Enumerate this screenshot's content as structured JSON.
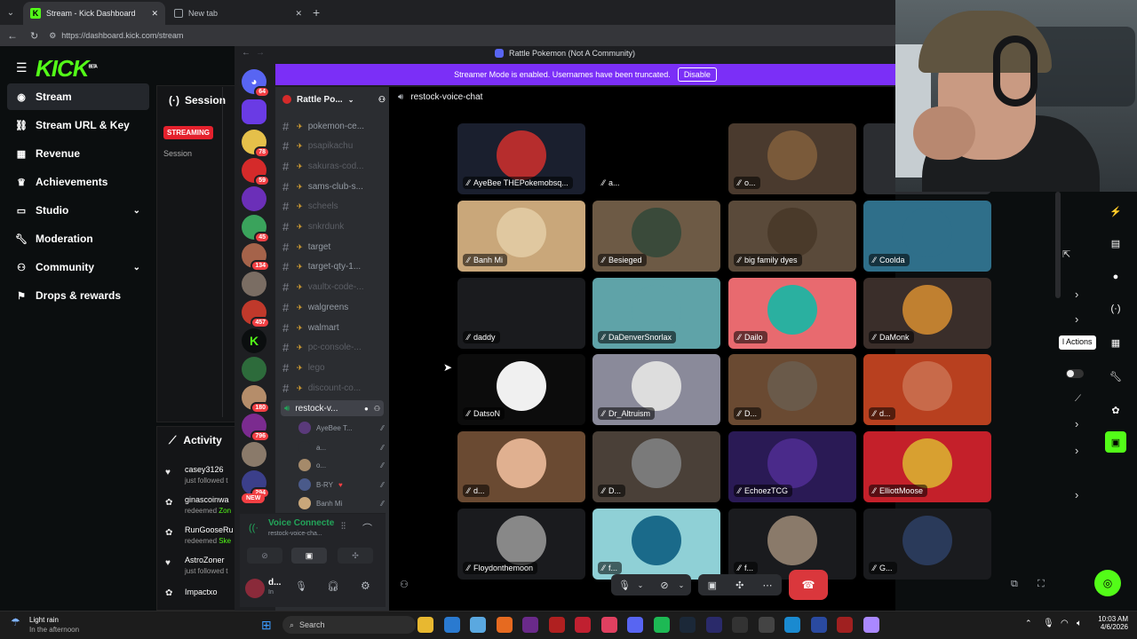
{
  "browser": {
    "tabs": [
      {
        "title": "Stream - Kick Dashboard"
      },
      {
        "title": "New tab"
      }
    ],
    "url": "https://dashboard.kick.com/stream"
  },
  "kick": {
    "logo": "KICK",
    "logo_sup": "BETA",
    "nav": [
      {
        "label": "Stream",
        "icon": "broadcast-icon"
      },
      {
        "label": "Stream URL & Key",
        "icon": "link-icon"
      },
      {
        "label": "Revenue",
        "icon": "revenue-icon"
      },
      {
        "label": "Achievements",
        "icon": "trophy-icon"
      },
      {
        "label": "Studio",
        "icon": "studio-icon"
      },
      {
        "label": "Moderation",
        "icon": "wrench-icon"
      },
      {
        "label": "Community",
        "icon": "community-icon"
      },
      {
        "label": "Drops & rewards",
        "icon": "gift-icon"
      }
    ],
    "session_title": "Session",
    "streaming_badge": "STREAMING",
    "session_label": "Session",
    "activity_title": "Activity",
    "activity": [
      {
        "name": "casey3126",
        "action": "just followed t",
        "icon": "heart-icon"
      },
      {
        "name": "ginascoinwa",
        "action": "redeemed",
        "extra": "Zon",
        "icon": "rewards-icon"
      },
      {
        "name": "RunGooseRu",
        "action": "redeemed",
        "extra": "Ske",
        "icon": "rewards-icon"
      },
      {
        "name": "AstroZoner",
        "action": "just followed t",
        "icon": "heart-icon"
      },
      {
        "name": "Impactxo",
        "action": "",
        "icon": "rewards-icon"
      }
    ],
    "quick_actions_tooltip": "l Actions"
  },
  "discord": {
    "window_title": "Rattle Pokemon (Not A Community)",
    "streamer_banner": "Streamer Mode is enabled. Usernames have been truncated.",
    "disable_label": "Disable",
    "server_name": "Rattle Po...",
    "guild_badges": [
      "64",
      "78",
      "59",
      "45",
      "134",
      "457",
      "180",
      "796",
      "294"
    ],
    "new_label": "NEW",
    "channels": [
      {
        "name": "pokemon-ce...",
        "dim": false
      },
      {
        "name": "psapikachu",
        "dim": true
      },
      {
        "name": "sakuras-cod...",
        "dim": true
      },
      {
        "name": "sams-club-s...",
        "dim": false
      },
      {
        "name": "scheels",
        "dim": true
      },
      {
        "name": "snkrdunk",
        "dim": true
      },
      {
        "name": "target",
        "dim": false
      },
      {
        "name": "target-qty-1...",
        "dim": false
      },
      {
        "name": "vaultx-code-...",
        "dim": true
      },
      {
        "name": "walgreens",
        "dim": false
      },
      {
        "name": "walmart",
        "dim": false
      },
      {
        "name": "pc-console-...",
        "dim": true
      },
      {
        "name": "lego",
        "dim": true
      },
      {
        "name": "discount-co...",
        "dim": true
      }
    ],
    "voice_channel": "restock-v...",
    "voice_users": [
      "AyeBee T...",
      "a...",
      "o...",
      "B-RY",
      "Banh Mi"
    ],
    "voice_connected": "Voice Connecte",
    "voice_channel_sub": "restock-voice-cha...",
    "user_short": "d...",
    "user_status": "In",
    "stage_title": "restock-voice-chat",
    "tiles": [
      {
        "name": "AyeBee THEPokemobsq...",
        "bg": "#1a1f2e"
      },
      {
        "name": "a...",
        "bg": "#000000"
      },
      {
        "name": "o...",
        "bg": "#4a3a2e"
      },
      {
        "name": "",
        "bg": "#2b2d31"
      },
      {
        "name": "Banh Mi",
        "bg": "#c9a77a"
      },
      {
        "name": "Besieged",
        "bg": "#6d5a45"
      },
      {
        "name": "big family dyes",
        "bg": "#5a4a3a"
      },
      {
        "name": "Coolda",
        "bg": "#2f6f8a"
      },
      {
        "name": "daddy",
        "bg": "#1a1b1e"
      },
      {
        "name": "DaDenverSnorlax",
        "bg": "#5fa3a8"
      },
      {
        "name": "Dailo",
        "bg": "#e86a6f"
      },
      {
        "name": "DaMonk",
        "bg": "#3a2e2a"
      },
      {
        "name": "DatsoN",
        "bg": "#0c0c0c"
      },
      {
        "name": "Dr_Altruism",
        "bg": "#8a8a9a"
      },
      {
        "name": "D...",
        "bg": "#6a4a32"
      },
      {
        "name": "d...",
        "bg": "#b8401f"
      },
      {
        "name": "d...",
        "bg": "#6a4a32"
      },
      {
        "name": "D...",
        "bg": "#4a4038"
      },
      {
        "name": "EchoezTCG",
        "bg": "#2a1a55"
      },
      {
        "name": "ElliottMoose",
        "bg": "#c4202a"
      },
      {
        "name": "Floydonthemoon",
        "bg": "#1a1b1e"
      },
      {
        "name": "f...",
        "bg": "#8fd0d6"
      },
      {
        "name": "f...",
        "bg": "#1a1b1e"
      },
      {
        "name": "G...",
        "bg": "#1a1b1e"
      }
    ]
  },
  "taskbar": {
    "weather_title": "Light rain",
    "weather_sub": "In the afternoon",
    "search_placeholder": "Search",
    "time": "10:03 AM",
    "date": "4/6/2026"
  },
  "colors": {
    "kick_green": "#53fc18",
    "discord_purple": "#5865f2",
    "streamer_banner": "#7b2ff7",
    "live_red": "#e5212d",
    "end_call": "#da373c"
  }
}
